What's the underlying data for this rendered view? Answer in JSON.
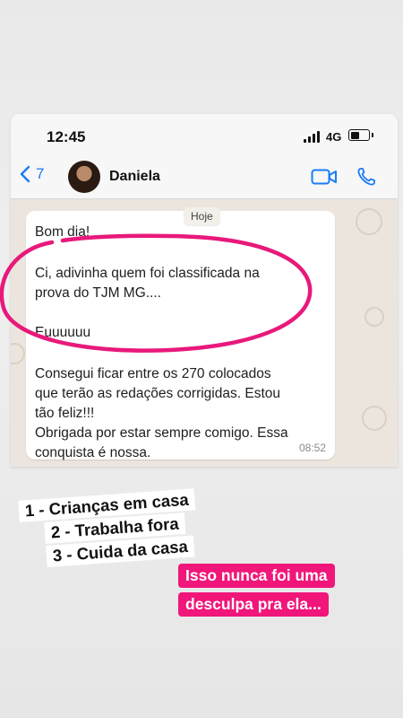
{
  "status_bar": {
    "time": "12:45",
    "network": "4G"
  },
  "chat_header": {
    "back_count": "7",
    "contact_name": "Daniela"
  },
  "chat": {
    "date_label": "Hoje",
    "message": {
      "lines": [
        "Bom dia!",
        "Ci, adivinha quem foi classificada na",
        "prova do TJM MG....",
        "Euuuuuu",
        "Consegui ficar entre os 270 colocados",
        "que terão as redações corrigidas. Estou",
        "tão feliz!!!",
        "Obrigada por estar sempre comigo. Essa",
        "conquista é nossa."
      ],
      "time": "08:52"
    }
  },
  "story_text": {
    "list": [
      "1 - Crianças em casa",
      "2 - Trabalha fora",
      "3 - Cuida da casa"
    ],
    "caption": [
      "Isso nunca foi uma",
      "desculpa pra ela..."
    ]
  },
  "colors": {
    "accent": "#1a7cf5",
    "highlight": "#e8197b",
    "caption_bg": "#f0167a",
    "chat_bg": "#ece5dd"
  },
  "icons": [
    "back-chevron-icon",
    "video-call-icon",
    "phone-call-icon",
    "signal-icon",
    "battery-icon"
  ]
}
